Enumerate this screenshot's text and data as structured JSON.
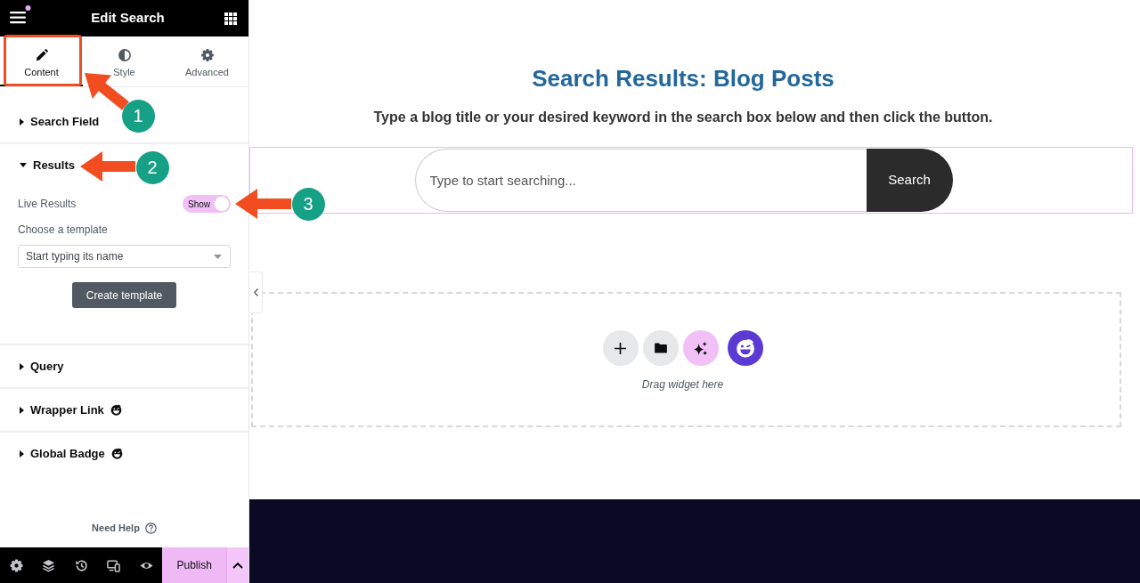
{
  "sidebar": {
    "title": "Edit Search",
    "tabs": [
      {
        "label": "Content",
        "selected": true
      },
      {
        "label": "Style",
        "selected": false
      },
      {
        "label": "Advanced",
        "selected": false
      }
    ],
    "sections": [
      {
        "title": "Search Field",
        "expanded": false,
        "trailing_icon": false
      },
      {
        "title": "Results",
        "expanded": true,
        "trailing_icon": false,
        "controls": [
          {
            "kind": "toggle",
            "label": "Live Results",
            "value": "Show",
            "on": true
          },
          {
            "kind": "select",
            "label": "Choose a template",
            "placeholder": "Start typing its name"
          },
          {
            "kind": "button",
            "label": "Create template"
          }
        ]
      },
      {
        "title": "Query",
        "expanded": false,
        "trailing_icon": false
      },
      {
        "title": "Wrapper Link",
        "expanded": false,
        "trailing_icon": true
      },
      {
        "title": "Global Badge",
        "expanded": false,
        "trailing_icon": true
      }
    ],
    "help": "Need Help",
    "publish": "Publish"
  },
  "canvas": {
    "heading": "Search Results: Blog Posts",
    "subheading": "Type a blog title or your desired keyword in the search box below and then click the button.",
    "search": {
      "placeholder": "Type to start searching...",
      "button": "Search"
    },
    "drop_zone": {
      "hint": "Drag widget here"
    }
  },
  "annotations": [
    {
      "label": "1"
    },
    {
      "label": "2"
    },
    {
      "label": "3"
    }
  ]
}
